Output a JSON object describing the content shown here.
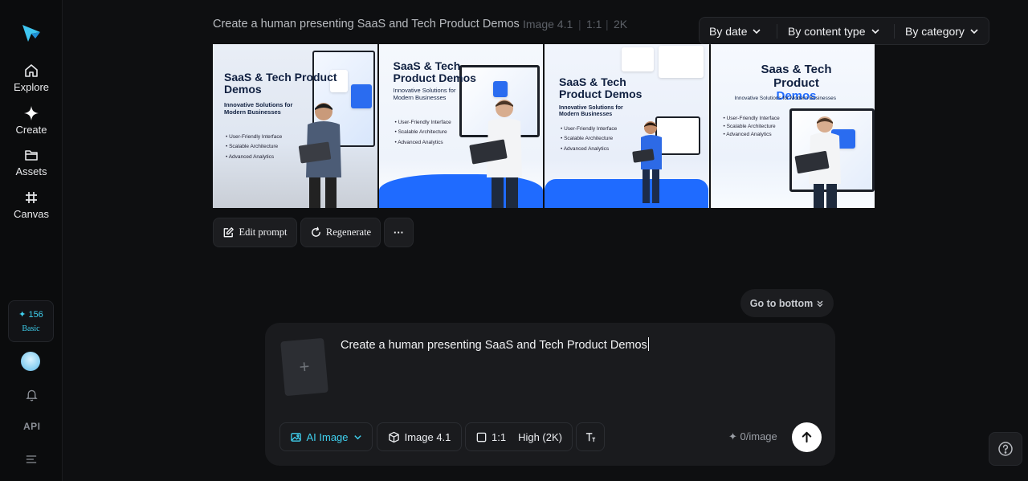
{
  "sidebar": {
    "items": [
      {
        "label": "Explore",
        "icon": "home-icon"
      },
      {
        "label": "Create",
        "icon": "sparkle-icon"
      },
      {
        "label": "Assets",
        "icon": "folder-icon"
      },
      {
        "label": "Canvas",
        "icon": "hash-icon"
      }
    ],
    "credits": {
      "value": "✦ 156",
      "tier": "Basic"
    },
    "api_label": "API"
  },
  "header": {
    "prompt": "Create a human presenting SaaS and Tech Product Demos",
    "model": "Image 4.1",
    "ratio": "1:1",
    "resolution": "2K"
  },
  "filters": {
    "by_date": "By date",
    "by_content_type": "By content type",
    "by_category": "By category"
  },
  "images": [
    {
      "title": "SaaS & Tech Product Demos",
      "subtitle": "Innovative Solutions for Modern Businesses",
      "bullets": [
        "User-Friendly Interface",
        "Scalable Architecture",
        "Advanced Analytics"
      ]
    },
    {
      "title": "SaaS & Tech Product Demos",
      "subtitle": "Innovative Solutions for Modern Businesses",
      "bullets": [
        "User-Friendly Interface",
        "Scalable Architecture",
        "Advanced Analytics"
      ]
    },
    {
      "title": "SaaS & Tech Product Demos",
      "subtitle": "Innovative Solutions for Modern Businesses",
      "bullets": [
        "User-Friendly Interface",
        "Scalable Architecture",
        "Advanced Analytics"
      ]
    },
    {
      "title_line1": "Saas & Tech",
      "title_line2": "Product",
      "title_accent": "Demos",
      "subtitle": "Innovative Solutions for Modern Businesses",
      "bullets": [
        "User-Friendly Interface",
        "Scalable Architecture",
        "Advanced Analytics"
      ]
    }
  ],
  "actions": {
    "edit_prompt": "Edit prompt",
    "regenerate": "Regenerate",
    "more": "···"
  },
  "go_to_bottom": "Go to bottom",
  "composer": {
    "text": "Create a human presenting SaaS and Tech Product Demos",
    "mode": "AI Image",
    "model": "Image 4.1",
    "ratio": "1:1",
    "quality": "High (2K)",
    "cost": "✦ 0/image"
  },
  "colors": {
    "accent": "#3fd0ee",
    "background": "#0e0f11",
    "panel": "#1a1b1e",
    "brand_blue": "#1f6bff"
  }
}
